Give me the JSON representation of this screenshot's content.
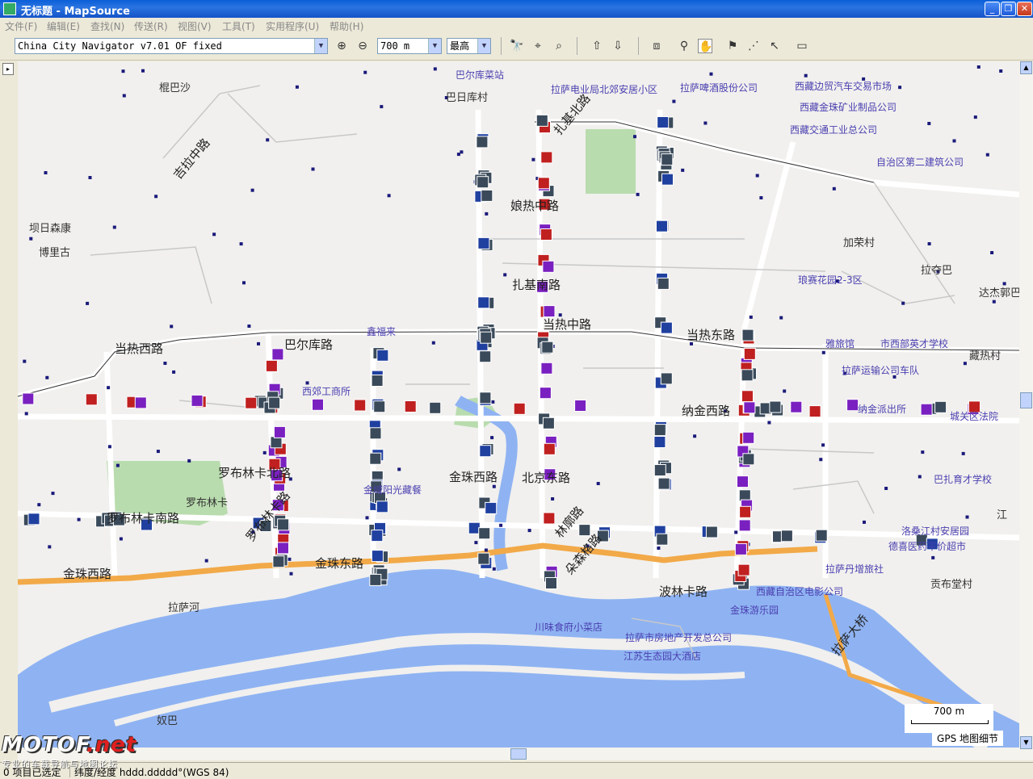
{
  "window": {
    "title": "无标题 - MapSource"
  },
  "menu": [
    "文件(F)",
    "编辑(E)",
    "查找(N)",
    "传送(R)",
    "视图(V)",
    "工具(T)",
    "实用程序(U)",
    "帮助(H)"
  ],
  "toolbar": {
    "map_product": "China City Navigator v7.01 OF fixed",
    "zoom_value": "700 m",
    "detail_value": "最高"
  },
  "map": {
    "scale_label": "700 m",
    "detail_label": "GPS 地图细节",
    "labels": [
      {
        "t": "棍巴沙",
        "k": "plain"
      },
      {
        "t": "巴尔库菜站",
        "k": "poi"
      },
      {
        "t": "巴日库村",
        "k": "plain"
      },
      {
        "t": "拉萨电业局北郊安居小区",
        "k": "poi"
      },
      {
        "t": "拉萨啤酒股份公司",
        "k": "poi"
      },
      {
        "t": "西藏边贸汽车交易市场",
        "k": "poi"
      },
      {
        "t": "西藏金珠矿业制品公司",
        "k": "poi"
      },
      {
        "t": "西藏交通工业总公司",
        "k": "poi"
      },
      {
        "t": "扎基北路",
        "k": "road"
      },
      {
        "t": "自治区第二建筑公司",
        "k": "poi"
      },
      {
        "t": "吉拉中路",
        "k": "road"
      },
      {
        "t": "坝日森康",
        "k": "plain"
      },
      {
        "t": "博里古",
        "k": "plain"
      },
      {
        "t": "娘热中路",
        "k": "road"
      },
      {
        "t": "扎基南路",
        "k": "road"
      },
      {
        "t": "加荣村",
        "k": "plain"
      },
      {
        "t": "拉夺巴",
        "k": "plain"
      },
      {
        "t": "琅赛花园2-3区",
        "k": "poi"
      },
      {
        "t": "达杰郭巴",
        "k": "plain"
      },
      {
        "t": "鑫福来",
        "k": "poi"
      },
      {
        "t": "当热西路",
        "k": "road"
      },
      {
        "t": "巴尔库路",
        "k": "road"
      },
      {
        "t": "当热中路",
        "k": "road"
      },
      {
        "t": "当热东路",
        "k": "road"
      },
      {
        "t": "雅旅馆",
        "k": "poi"
      },
      {
        "t": "市西部英才学校",
        "k": "poi"
      },
      {
        "t": "藏热村",
        "k": "plain"
      },
      {
        "t": "拉萨运输公司车队",
        "k": "poi"
      },
      {
        "t": "西郊工商所",
        "k": "poi"
      },
      {
        "t": "纳金西路",
        "k": "road"
      },
      {
        "t": "纳金派出所",
        "k": "poi"
      },
      {
        "t": "城关区法院",
        "k": "poi"
      },
      {
        "t": "罗布林卡北路",
        "k": "road"
      },
      {
        "t": "金珠西路",
        "k": "road"
      },
      {
        "t": "北京东路",
        "k": "road"
      },
      {
        "t": "巴扎育才学校",
        "k": "poi"
      },
      {
        "t": "罗布林卡",
        "k": "plain"
      },
      {
        "t": "罗布林卡南路",
        "k": "road"
      },
      {
        "t": "罗布林卡路",
        "k": "road"
      },
      {
        "t": "金域阳光藏餐",
        "k": "poi"
      },
      {
        "t": "金珠西路",
        "k": "road"
      },
      {
        "t": "金珠东路",
        "k": "road"
      },
      {
        "t": "洛桑江村安居园",
        "k": "poi"
      },
      {
        "t": "德喜医药平价超市",
        "k": "poi"
      },
      {
        "t": "拉萨丹增旅社",
        "k": "poi"
      },
      {
        "t": "贡布堂村",
        "k": "plain"
      },
      {
        "t": "拉萨河",
        "k": "plain"
      },
      {
        "t": "波林卡路",
        "k": "road"
      },
      {
        "t": "西藏自治区电影公司",
        "k": "poi"
      },
      {
        "t": "金珠游乐园",
        "k": "poi"
      },
      {
        "t": "川味食府小菜店",
        "k": "poi"
      },
      {
        "t": "拉萨市房地产开发总公司",
        "k": "poi"
      },
      {
        "t": "江苏生态园大酒店",
        "k": "poi"
      },
      {
        "t": "拉萨大桥",
        "k": "road"
      },
      {
        "t": "奴巴",
        "k": "plain"
      },
      {
        "t": "江",
        "k": "plain"
      },
      {
        "t": "林廓路",
        "k": "road"
      },
      {
        "t": "朵森格路",
        "k": "road"
      }
    ]
  },
  "status": {
    "selection": "0 项目已选定",
    "coords_format": "纬度/经度 hddd.ddddd°(WGS 84)"
  },
  "watermark": {
    "brand_a": "MOTOF",
    "brand_b": ".net",
    "sub": "专业的车载导航与地图论坛"
  }
}
